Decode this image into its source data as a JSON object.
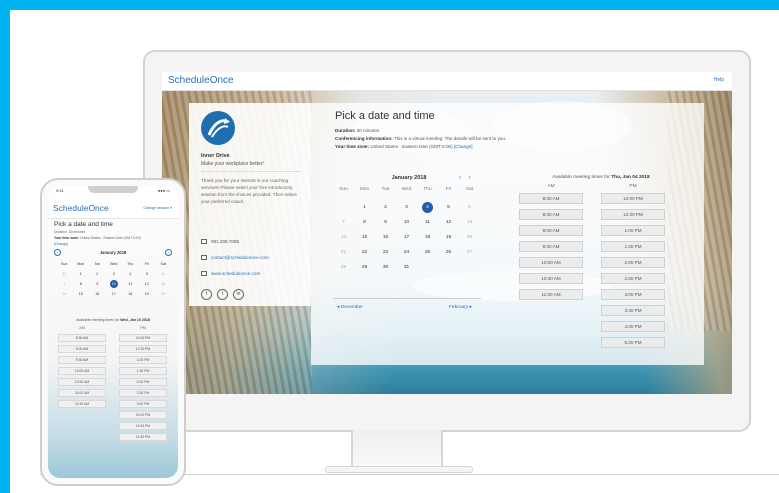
{
  "colors": {
    "frame": "#00b4f0",
    "accent": "#2a6fb3",
    "selected_day": "#1f5fa6"
  },
  "desktop": {
    "app": {
      "logo": "ScheduleOnce",
      "help": "Help"
    },
    "profile": {
      "name": "Inner Drive",
      "tagline": "Make your workplace better!",
      "message": "Thank you for your interest in our coaching services! Please select your free introductory session from the choices provided. Then select your preferred coach.",
      "phone": "091.208.7089",
      "email": "contact@scheduleonce.com",
      "website": "www.scheduleonce.com",
      "social": [
        "f",
        "t",
        "in"
      ]
    },
    "booking": {
      "title": "Pick a date and time",
      "duration_label": "Duration:",
      "duration_value": "30 minutes",
      "conf_label": "Conferencing information:",
      "conf_value": "This is a virtual meeting. The details will be sent to you.",
      "tz_label": "Your time zone:",
      "tz_value": "United States - Eastern time (GMT-5:00)",
      "tz_change": "[Change]"
    },
    "calendar": {
      "month": "January 2018",
      "arrows": "‹ ›",
      "dow": [
        "Sun",
        "Mon",
        "Tue",
        "Wed",
        "Thu",
        "Fri",
        "Sat"
      ],
      "weeks": [
        [
          "",
          "1",
          "2",
          "3",
          "4",
          "5",
          "6"
        ],
        [
          "7",
          "8",
          "9",
          "10",
          "11",
          "12",
          "13"
        ],
        [
          "14",
          "15",
          "16",
          "17",
          "18",
          "19",
          "20"
        ],
        [
          "21",
          "22",
          "23",
          "24",
          "25",
          "26",
          "27"
        ],
        [
          "28",
          "29",
          "30",
          "31",
          "",
          "",
          ""
        ]
      ],
      "selected": "4",
      "prev": "◂ December",
      "next": "February ▸"
    },
    "slots": {
      "label": "Available meeting times for",
      "date": "Thu, Jan 04 2018",
      "am_header": "AM",
      "pm_header": "PM",
      "am": [
        "8:30 AM",
        "8:30 AM",
        "9:00 AM",
        "9:30 AM",
        "10:00 AM",
        "10:30 AM",
        "11:00 AM"
      ],
      "pm": [
        "12:00 PM",
        "12:30 PM",
        "1:00 PM",
        "1:30 PM",
        "2:00 PM",
        "2:30 PM",
        "3:00 PM",
        "3:30 PM",
        "4:30 PM",
        "5:30 PM"
      ]
    }
  },
  "phone": {
    "status": {
      "time": "9:41",
      "icons": "●●● ▭"
    },
    "logo": "ScheduleOnce",
    "change": "Change session ▾",
    "title": "Pick a date and time",
    "duration": "Duration: 30 minutes",
    "tz_label": "Your time zone:",
    "tz_value": "United States - Eastern time (GMT-5:00)",
    "change_link": "[Change]",
    "month": "January 2018",
    "dow": [
      "Sun",
      "Mon",
      "Tue",
      "Wed",
      "Thu",
      "Fri",
      "Sat"
    ],
    "weeks": [
      [
        "31",
        "1",
        "2",
        "3",
        "4",
        "5",
        "6"
      ],
      [
        "7",
        "8",
        "9",
        "10",
        "11",
        "12",
        "13"
      ],
      [
        "14",
        "15",
        "16",
        "17",
        "18",
        "19",
        "20"
      ]
    ],
    "selected": "10",
    "avail_label": "Available meeting times for",
    "avail_date": "Wed, Jan 10 2018",
    "am_header": "AM",
    "pm_header": "PM",
    "am": [
      "8:30 AM",
      "9:00 AM",
      "9:30 AM",
      "10:00 AM",
      "10:30 AM",
      "11:00 AM",
      "11:30 AM"
    ],
    "pm": [
      "12:00 PM",
      "12:30 PM",
      "1:00 PM",
      "1:30 PM",
      "2:00 PM",
      "2:30 PM",
      "3:00 PM",
      "10:00 PM",
      "11:00 PM",
      "11:30 PM"
    ]
  }
}
